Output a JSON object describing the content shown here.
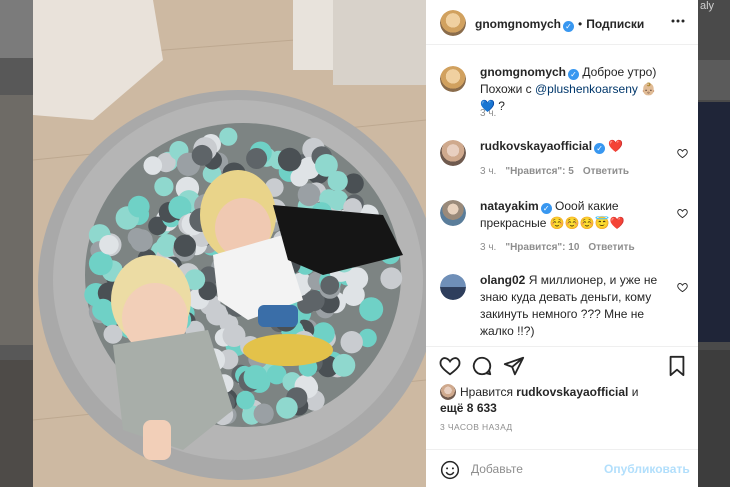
{
  "background": {
    "right_fragment_text": "aly"
  },
  "post": {
    "author": "gnomgnomych",
    "dot": "•",
    "follow_label": "Подписки",
    "caption": {
      "text_before": "Доброе утро)",
      "text_line2": "Похожи с ",
      "mention": "@plushenkoarseny",
      "emojis_end": "👶🏼💙 ?",
      "time": "3 ч."
    },
    "comments": [
      {
        "user": "rudkovskayaofficial",
        "verified": true,
        "text": "❤️",
        "time": "3 ч.",
        "likes": "\"Нравится\": 5",
        "reply": "Ответить"
      },
      {
        "user": "natayakim",
        "verified": true,
        "text": "Ооой какие прекрасные ☺️☺️☺️😇❤️",
        "time": "3 ч.",
        "likes": "\"Нравится\": 10",
        "reply": "Ответить"
      },
      {
        "user": "olang02",
        "verified": false,
        "text": "Я миллионер, и уже не знаю куда девать деньги, кому закинуть немного ??? Мне не жалко !!?)"
      }
    ],
    "likes_prefix": "Нравится ",
    "likes_user": "rudkovskayaofficial",
    "likes_and": " и",
    "likes_more": "ещё 8 633",
    "time_ago": "3 ЧАСОВ НАЗАД",
    "add_comment_placeholder": "Добавьте",
    "publish_label": "Опубликовать"
  },
  "colors": {
    "accent": "#3897f0",
    "publish_disabled": "#b2dffc",
    "muted": "#8e8e8e"
  }
}
